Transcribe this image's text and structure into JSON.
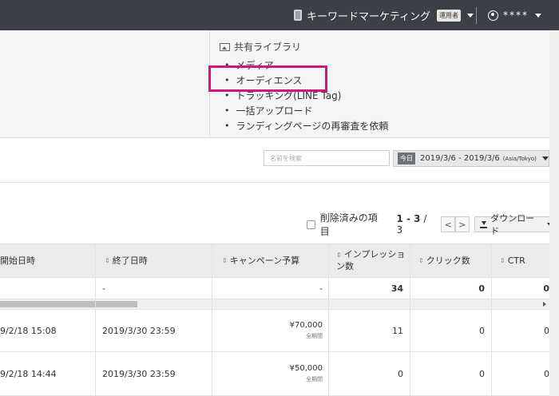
{
  "topbar": {
    "account_name": "キーワードマーケティング",
    "role_badge": "運用者",
    "user_name": "****"
  },
  "library": {
    "heading": "共有ライブラリ",
    "items": [
      "メディア",
      "オーディエンス",
      "トラッキング(LINE Tag)",
      "一括アップロード",
      "ランディングページの再審査を依頼"
    ],
    "highlighted_item": "オーディエンス",
    "highlight_color": "#d6137e"
  },
  "filters": {
    "search_placeholder": "名前を検索",
    "today_badge": "今日",
    "date_range": "2019/3/6 - 2019/3/6",
    "timezone": "(Asia/Tokyo)"
  },
  "table_controls": {
    "deleted_label": "削除済みの項目",
    "page_range": "1 - 3",
    "page_sep": "/",
    "page_total": "3",
    "prev": "<",
    "next": ">",
    "download_label": "ダウンロード"
  },
  "table": {
    "headers": {
      "start": "開始日時",
      "end": "終了日時",
      "budget": "キャンペーン予算",
      "impressions_1": "インプレッショ",
      "impressions_2": "ン数",
      "clicks": "クリック数",
      "ctr": "CTR"
    },
    "summary": {
      "end": "-",
      "budget": "-",
      "impressions": "34",
      "clicks": "0",
      "ctr": "0"
    },
    "rows": [
      {
        "start": "9/2/18 15:08",
        "end": "2019/3/30 23:59",
        "budget": "¥70,000",
        "period": "全期間",
        "impressions": "11",
        "clicks": "0",
        "ctr": "0"
      },
      {
        "start": "9/2/18 14:44",
        "end": "2019/3/30 23:59",
        "budget": "¥50,000",
        "period": "全期間",
        "impressions": "0",
        "clicks": "0",
        "ctr": "0"
      }
    ]
  },
  "colors": {
    "topbar_bg": "#3b3f46",
    "panel_bg": "#f4f5f7",
    "header_bg": "#eaebed"
  },
  "icons": [
    "phone-icon",
    "user-icon",
    "image-icon",
    "download-icon",
    "sort-icon",
    "caret-down-icon"
  ]
}
